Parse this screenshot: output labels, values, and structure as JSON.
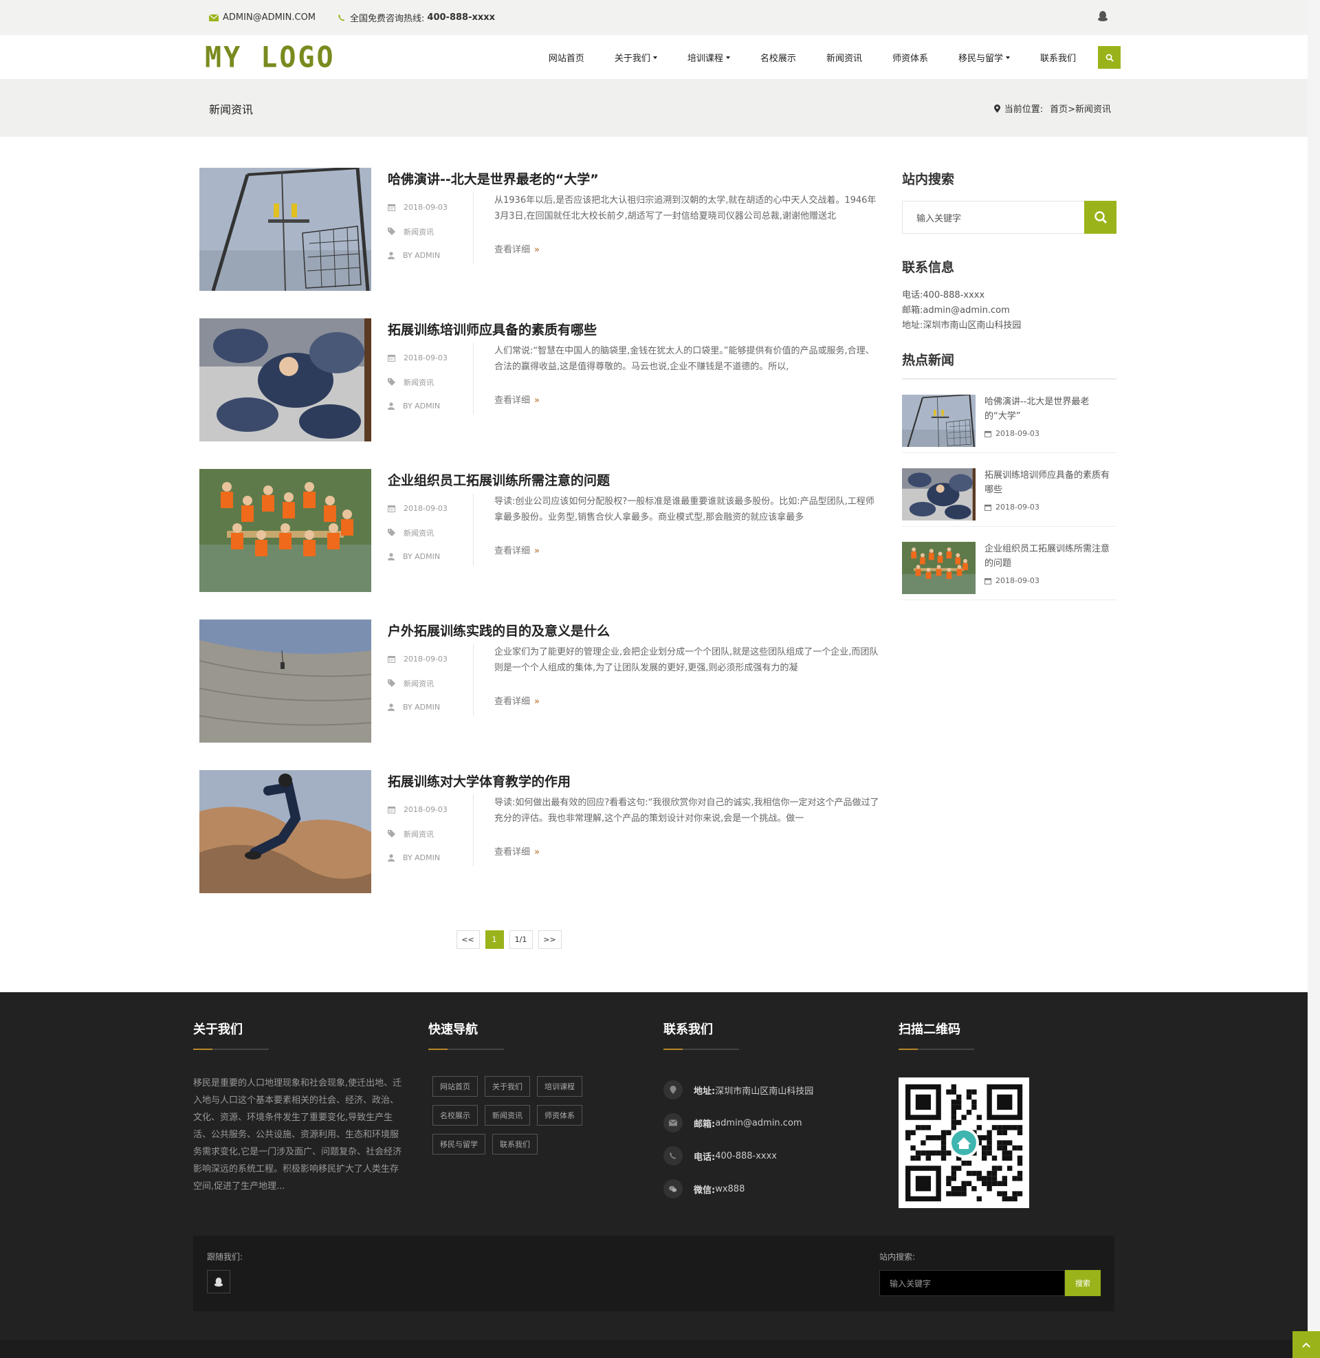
{
  "topbar": {
    "email": "ADMIN@ADMIN.COM",
    "hotline_label": "全国免费咨询热线:",
    "hotline": "400-888-xxxx"
  },
  "header": {
    "logo": "MY LOGO",
    "nav": [
      {
        "label": "网站首页",
        "dropdown": false
      },
      {
        "label": "关于我们",
        "dropdown": true
      },
      {
        "label": "培训课程",
        "dropdown": true
      },
      {
        "label": "名校展示",
        "dropdown": false
      },
      {
        "label": "新闻资讯",
        "dropdown": false
      },
      {
        "label": "师资体系",
        "dropdown": false
      },
      {
        "label": "移民与留学",
        "dropdown": true
      },
      {
        "label": "联系我们",
        "dropdown": false
      }
    ]
  },
  "titleband": {
    "title": "新闻资讯",
    "crumb_label": "当前位置:",
    "crumb_path": "首页>新闻资讯"
  },
  "posts": [
    {
      "title": "哈佛演讲--北大是世界最老的“大学”",
      "date": "2018-09-03",
      "category": "新闻资讯",
      "author": "BY ADMIN",
      "excerpt": "从1936年以后,是否应该把北大认祖归宗追溯到汉朝的太学,就在胡适的心中天人交战着。1946年3月3日,在回国就任北大校长前夕,胡适写了一封信给夏晓司仪器公司总裁,谢谢他赠送北",
      "more": "查看详细",
      "image": "rope-course"
    },
    {
      "title": "拓展训练培训师应具备的素质有哪些",
      "date": "2018-09-03",
      "category": "新闻资讯",
      "author": "BY ADMIN",
      "excerpt": "人们常说:“智慧在中国人的脑袋里,金钱在犹太人的口袋里。”能够提供有价值的产品或服务,合理、合法的赢得收益,这是值得尊敬的。马云也说,企业不赚钱是不道德的。所以,",
      "more": "查看详细",
      "image": "camo-training"
    },
    {
      "title": "企业组织员工拓展训练所需注意的问题",
      "date": "2018-09-03",
      "category": "新闻资讯",
      "author": "BY ADMIN",
      "excerpt": "导读:创业公司应该如何分配股权?一般标准是谁最重要谁就该最多股份。比如:产品型团队,工程师拿最多股份。业务型,销售合伙人拿最多。商业模式型,那会融资的就应该拿最多",
      "more": "查看详细",
      "image": "team-river"
    },
    {
      "title": "户外拓展训练实践的目的及意义是什么",
      "date": "2018-09-03",
      "category": "新闻资讯",
      "author": "BY ADMIN",
      "excerpt": "企业家们为了能更好的管理企业,会把企业划分成一个个团队,就是这些团队组成了一个企业,而团队则是一个个人组成的集体,为了让团队发展的更好,更强,则必须形成强有力的凝",
      "more": "查看详细",
      "image": "dam-climb"
    },
    {
      "title": "拓展训练对大学体育教学的作用",
      "date": "2018-09-03",
      "category": "新闻资讯",
      "author": "BY ADMIN",
      "excerpt": "导读:如何做出最有效的回应?看看这句:“我很欣赏你对自己的诚实,我相信你一定对这个产品做过了充分的评估。我也非常理解,这个产品的策划设计对你来说,会是一个挑战。做一",
      "more": "查看详细",
      "image": "rock-runner"
    }
  ],
  "pager": {
    "prev": "<<",
    "current": "1",
    "total": "1/1",
    "next": ">>"
  },
  "sidebar": {
    "search_title": "站内搜索",
    "search_placeholder": "输入关键字",
    "contact_title": "联系信息",
    "contact_lines": [
      "电话:400-888-xxxx",
      "邮箱:admin@admin.com",
      "地址:深圳市南山区南山科技园"
    ],
    "hot_title": "热点新闻",
    "hot": [
      {
        "title": "哈佛演讲--北大是世界最老的“大学”",
        "date": "2018-09-03"
      },
      {
        "title": "拓展训练培训师应具备的素质有哪些",
        "date": "2018-09-03"
      },
      {
        "title": "企业组织员工拓展训练所需注意的问题",
        "date": "2018-09-03"
      }
    ]
  },
  "footer": {
    "about_title": "关于我们",
    "about_text": "移民是重要的人口地理现象和社会现象,使迁出地、迁入地与人口这个基本要素相关的社会、经济、政治、文化、资源、环境条件发生了重要变化,导致生产生活、公共服务、公共设施、资源利用、生态和环境服务需求变化,它是一门涉及面广、问题复杂、社会经济影响深远的系统工程。积极影响移民扩大了人类生存空间,促进了生产地理...",
    "nav_title": "快速导航",
    "nav_tags": [
      "网站首页",
      "关于我们",
      "培训课程",
      "名校展示",
      "新闻资讯",
      "师资体系",
      "移民与留学",
      "联系我们"
    ],
    "contact_title": "联系我们",
    "contact": [
      {
        "label": "地址:",
        "value": "深圳市南山区南山科技园"
      },
      {
        "label": "邮箱:",
        "value": "admin@admin.com"
      },
      {
        "label": "电话:",
        "value": "400-888-xxxx"
      },
      {
        "label": "微信:",
        "value": "wx888"
      }
    ],
    "qr_title": "扫描二维码",
    "follow_label": "跟随我们:",
    "search_label": "站内搜索:",
    "search_placeholder": "输入关键字",
    "search_button": "搜索"
  },
  "colors": {
    "accent": "#9bb31a",
    "logo": "#7a8a1e",
    "footer_bg": "#222222",
    "footer_line": "#b8862b"
  }
}
